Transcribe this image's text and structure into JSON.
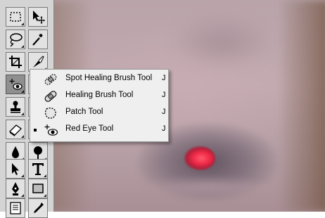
{
  "toolbox": {
    "tools": [
      {
        "name": "rectangular-marquee-tool-icon"
      },
      {
        "name": "move-tool-icon"
      },
      {
        "name": "lasso-tool-icon"
      },
      {
        "name": "magic-wand-tool-icon"
      },
      {
        "name": "crop-tool-icon"
      },
      {
        "name": "slice-tool-icon"
      },
      {
        "name": "red-eye-tool-icon",
        "active": true
      },
      {
        "name": "brush-tool-icon"
      },
      {
        "name": "clone-stamp-tool-icon"
      },
      {
        "name": "history-brush-tool-icon"
      },
      {
        "name": "eraser-tool-icon"
      },
      {
        "name": "gradient-tool-icon"
      },
      {
        "name": "blur-tool-icon"
      },
      {
        "name": "dodge-tool-icon"
      },
      {
        "name": "path-selection-tool-icon"
      },
      {
        "name": "type-tool-icon"
      },
      {
        "name": "pen-tool-icon"
      },
      {
        "name": "rectangle-tool-icon"
      },
      {
        "name": "notes-tool-icon"
      },
      {
        "name": "eyedropper-tool-icon"
      }
    ]
  },
  "flyout": {
    "items": [
      {
        "label": "Spot Healing Brush Tool",
        "shortcut": "J",
        "icon": "spot-healing-brush-icon",
        "selected": false
      },
      {
        "label": "Healing Brush Tool",
        "shortcut": "J",
        "icon": "healing-brush-icon",
        "selected": false
      },
      {
        "label": "Patch Tool",
        "shortcut": "J",
        "icon": "patch-tool-icon",
        "selected": false
      },
      {
        "label": "Red Eye Tool",
        "shortcut": "J",
        "icon": "red-eye-tool-icon",
        "selected": true
      }
    ]
  },
  "colors": {
    "red_eye": "#f02a48",
    "palette_bg": "#d4d4d4",
    "menu_bg": "#efefef"
  }
}
